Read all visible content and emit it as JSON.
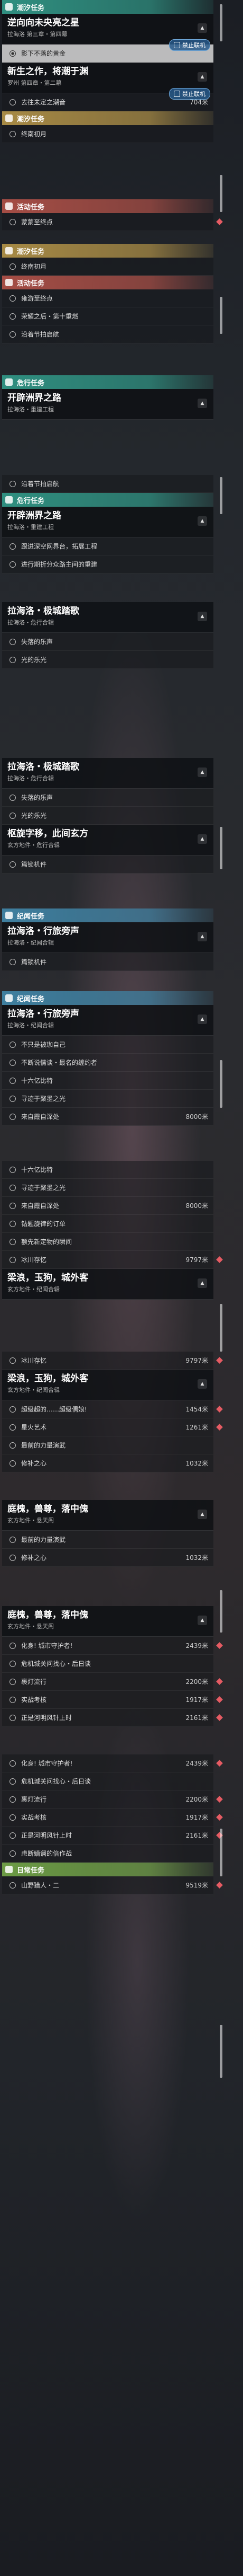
{
  "colors": {
    "teal": "#2f8f80",
    "gold": "#a78a45",
    "red": "#a54d45",
    "blue": "#3f7f9f",
    "green": "#6c9b45",
    "selected_row": "#d2d2d2",
    "marker": "#e55b63",
    "pill": "#285a8c"
  },
  "icons": {
    "category": "quest-category-icon",
    "row": "radio-circle-icon",
    "expand": "chevron-up-icon",
    "marker": "diamond-marker-icon",
    "pill": "gamepad-icon"
  },
  "badges": {
    "no_coop": "禁止联机"
  },
  "segments": [
    {
      "items": [
        {
          "kind": "cat",
          "color": "teal",
          "label": "潮汐任务"
        },
        {
          "kind": "head",
          "title": "逆向向未央亮之星",
          "sub": "拉海洛 第三章・第四幕"
        },
        {
          "kind": "row",
          "text": "影下不落的黄金",
          "sel": true,
          "pill": true
        },
        {
          "kind": "head",
          "title": "新生之作，将潮于渊",
          "sub": "罗州 第四章・第二幕"
        },
        {
          "kind": "row",
          "text": "去往未定之潮音",
          "dist": "704米",
          "pill": true
        },
        {
          "kind": "cat",
          "color": "gold",
          "label": "潮汐任务"
        },
        {
          "kind": "row",
          "text": "终南初月"
        }
      ]
    },
    {
      "items": [
        {
          "kind": "cat",
          "color": "red",
          "label": "活动任务"
        },
        {
          "kind": "row",
          "text": "蒙蒙至终点",
          "marker": true
        }
      ]
    },
    {
      "items": [
        {
          "kind": "cat",
          "color": "gold",
          "label": "潮汐任务"
        },
        {
          "kind": "row",
          "text": "终南初月"
        },
        {
          "kind": "cat",
          "color": "red",
          "label": "活动任务"
        },
        {
          "kind": "row",
          "text": "雍游至终点"
        },
        {
          "kind": "row",
          "text": "荣耀之后・第十重燃"
        },
        {
          "kind": "row",
          "text": "沿着节拍启航"
        }
      ]
    },
    {
      "items": [
        {
          "kind": "cat",
          "color": "teal",
          "label": "危行任务"
        },
        {
          "kind": "head",
          "title": "开辟洲界之路",
          "sub": "拉海洛・重建工程"
        }
      ]
    },
    {
      "items": [
        {
          "kind": "row",
          "text": "沿着节拍启航"
        },
        {
          "kind": "cat",
          "color": "teal",
          "label": "危行任务"
        },
        {
          "kind": "head",
          "title": "开辟洲界之路",
          "sub": "拉海洛・重建工程"
        },
        {
          "kind": "row",
          "text": "跟进深空网界台，拓展工程"
        },
        {
          "kind": "row",
          "text": "进行期折分众路主间的重建"
        }
      ]
    },
    {
      "items": [
        {
          "kind": "head",
          "title": "拉海洛・极城踏歌",
          "sub": "拉海洛・危行合辑"
        },
        {
          "kind": "row",
          "text": "失落的乐声"
        },
        {
          "kind": "row",
          "text": "光的乐光"
        }
      ]
    },
    {
      "items": [
        {
          "kind": "head",
          "title": "拉海洛・极城踏歌",
          "sub": "拉海洛・危行合辑"
        },
        {
          "kind": "row",
          "text": "失落的乐声"
        },
        {
          "kind": "row",
          "text": "光的乐光"
        },
        {
          "kind": "head",
          "title": "枢旋字移，此间玄方",
          "sub": "玄方地件・危行合辑"
        },
        {
          "kind": "row",
          "text": "篇锁机件"
        }
      ]
    },
    {
      "items": [
        {
          "kind": "cat",
          "color": "blue",
          "label": "纪闻任务"
        },
        {
          "kind": "head",
          "title": "拉海洛・行旅旁声",
          "sub": "拉海洛・纪闻合辑"
        },
        {
          "kind": "row",
          "text": "篇锁机件"
        }
      ]
    },
    {
      "items": [
        {
          "kind": "cat",
          "color": "blue",
          "label": "纪闻任务"
        },
        {
          "kind": "head",
          "title": "拉海洛・行旅旁声",
          "sub": "拉海洛・纪闻合辑"
        },
        {
          "kind": "row",
          "text": "不只是被珈自己"
        },
        {
          "kind": "row",
          "text": "不断说情谈・最名的缠约者"
        },
        {
          "kind": "row",
          "text": "十六亿比特"
        },
        {
          "kind": "row",
          "text": "寻迹于聚墨之光"
        },
        {
          "kind": "row",
          "text": "来自霞自深处",
          "dist": "8000米"
        }
      ]
    },
    {
      "items": [
        {
          "kind": "row",
          "text": "十六亿比特"
        },
        {
          "kind": "row",
          "text": "寻迹于聚墨之光"
        },
        {
          "kind": "row",
          "text": "来自霞自深处",
          "dist": "8000米"
        },
        {
          "kind": "row",
          "text": "钻题旋律的订单"
        },
        {
          "kind": "row",
          "text": "额先新定物的瞬间"
        },
        {
          "kind": "row",
          "text": "冰川存忆",
          "dist": "9797米",
          "marker": true
        },
        {
          "kind": "head",
          "title": "梁浪，玉狗，城外客",
          "sub": "玄方地件・纪闻合辑"
        }
      ]
    },
    {
      "items": [
        {
          "kind": "row",
          "text": "冰川存忆",
          "dist": "9797米",
          "marker": true
        },
        {
          "kind": "head",
          "title": "梁浪，玉狗，城外客",
          "sub": "玄方地件・纪闻合辑"
        },
        {
          "kind": "row",
          "text": "超级超的……超级偶娘!",
          "dist": "1454米",
          "marker": true
        },
        {
          "kind": "row",
          "text": "星火艺术",
          "dist": "1261米",
          "marker": true
        },
        {
          "kind": "row",
          "text": "最前的力量演武"
        },
        {
          "kind": "row",
          "text": "修补之心",
          "dist": "1032米"
        }
      ]
    },
    {
      "items": [
        {
          "kind": "head",
          "title": "庭槐，兽尊，落中傀",
          "sub": "玄方地件・悬天阁"
        },
        {
          "kind": "row",
          "text": "最前的力量演武"
        },
        {
          "kind": "row",
          "text": "修补之心",
          "dist": "1032米"
        }
      ]
    },
    {
      "items": [
        {
          "kind": "head",
          "title": "庭槐，兽尊，落中傀",
          "sub": "玄方地件・悬天阁"
        },
        {
          "kind": "row",
          "text": "化身! 城市守护者!",
          "dist": "2439米",
          "marker": true
        },
        {
          "kind": "row",
          "text": "危机城关问找心・后日谈"
        },
        {
          "kind": "row",
          "text": "裹灯流行",
          "dist": "2200米",
          "marker": true
        },
        {
          "kind": "row",
          "text": "实战考核",
          "dist": "1917米",
          "marker": true
        },
        {
          "kind": "row",
          "text": "正是河明风针上时",
          "dist": "2161米",
          "marker": true
        }
      ]
    },
    {
      "items": [
        {
          "kind": "row",
          "text": "化身! 城市守护者!",
          "dist": "2439米",
          "marker": true
        },
        {
          "kind": "row",
          "text": "危机城关问找心・后日谈"
        },
        {
          "kind": "row",
          "text": "裹灯流行",
          "dist": "2200米",
          "marker": true
        },
        {
          "kind": "row",
          "text": "实战考核",
          "dist": "1917米",
          "marker": true
        },
        {
          "kind": "row",
          "text": "正是河明风针上时",
          "dist": "2161米",
          "marker": true
        },
        {
          "kind": "row",
          "text": "虑断嫡谰的倍作战"
        },
        {
          "kind": "cat",
          "color": "green",
          "label": "日常任务"
        },
        {
          "kind": "row",
          "text": "山野猎人・二",
          "dist": "9519米",
          "marker": true
        }
      ]
    }
  ]
}
